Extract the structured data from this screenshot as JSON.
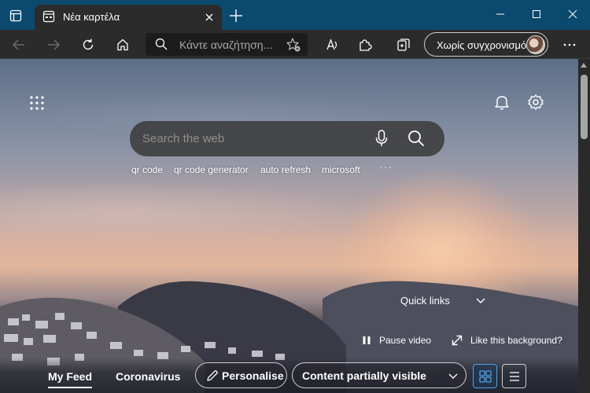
{
  "tab": {
    "title": "Νέα καρτέλα"
  },
  "address_bar": {
    "placeholder": "Κάντε αναζήτηση..."
  },
  "profile": {
    "label": "Χωρίς συγχρονισμό"
  },
  "search": {
    "placeholder": "Search the web",
    "suggestions": [
      "qr code",
      "qr code generator",
      "auto refresh",
      "microsoft"
    ],
    "more": "···"
  },
  "quick_links": {
    "label": "Quick links"
  },
  "background_controls": {
    "pause_label": "Pause video",
    "like_label": "Like this background?"
  },
  "feed": {
    "tabs": [
      {
        "label": "My Feed",
        "active": true
      },
      {
        "label": "Coronavirus",
        "active": false
      }
    ],
    "personalise_label": "Personalise",
    "visibility_label": "Content partially visible"
  },
  "colors": {
    "titlebar": "#0b4a6e",
    "toolbar": "#2b2b2b",
    "accent": "#4aa3e8"
  },
  "icons": [
    "tab-actions-icon",
    "page-favicon",
    "close-icon",
    "plus-icon",
    "minimize-icon",
    "maximize-icon",
    "close-window-icon",
    "back-arrow-icon",
    "forward-arrow-icon",
    "refresh-icon",
    "home-icon",
    "search-icon",
    "favorite-star-icon",
    "read-aloud-icon",
    "extensions-icon",
    "collections-icon",
    "apps-grid-icon",
    "bell-icon",
    "gear-icon",
    "microphone-icon",
    "chevron-down-icon",
    "pause-icon",
    "expand-icon",
    "pencil-icon",
    "grid-view-icon",
    "list-view-icon"
  ]
}
